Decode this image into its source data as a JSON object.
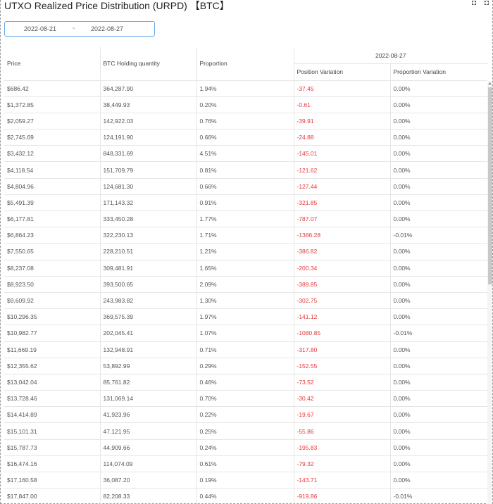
{
  "page": {
    "title": "UTXO Realized Price Distribution (URPD) 【BTC】"
  },
  "date_range": {
    "start": "2022-08-21",
    "separator": "~",
    "end": "2022-08-27"
  },
  "table": {
    "columns": {
      "price": "Price",
      "holding": "BTC Holding quantity",
      "proportion": "Proportion",
      "group_date": "2022-08-27",
      "position_variation": "Position Variation",
      "proportion_variation": "Proportion Variation"
    },
    "rows": [
      {
        "price": "$686.42",
        "holding": "364,287.90",
        "proportion": "1.94%",
        "pos_var": "-37.45",
        "prop_var": "0.00%"
      },
      {
        "price": "$1,372.85",
        "holding": "38,449.93",
        "proportion": "0.20%",
        "pos_var": "-0.61",
        "prop_var": "0.00%"
      },
      {
        "price": "$2,059.27",
        "holding": "142,922.03",
        "proportion": "0.76%",
        "pos_var": "-39.91",
        "prop_var": "0.00%"
      },
      {
        "price": "$2,745.69",
        "holding": "124,191.90",
        "proportion": "0.66%",
        "pos_var": "-24.88",
        "prop_var": "0.00%"
      },
      {
        "price": "$3,432.12",
        "holding": "848,331.69",
        "proportion": "4.51%",
        "pos_var": "-145.01",
        "prop_var": "0.00%"
      },
      {
        "price": "$4,118.54",
        "holding": "151,709.79",
        "proportion": "0.81%",
        "pos_var": "-121.62",
        "prop_var": "0.00%"
      },
      {
        "price": "$4,804.96",
        "holding": "124,681.30",
        "proportion": "0.66%",
        "pos_var": "-127.44",
        "prop_var": "0.00%"
      },
      {
        "price": "$5,491.39",
        "holding": "171,143.32",
        "proportion": "0.91%",
        "pos_var": "-321.85",
        "prop_var": "0.00%"
      },
      {
        "price": "$6,177.81",
        "holding": "333,450.28",
        "proportion": "1.77%",
        "pos_var": "-787.07",
        "prop_var": "0.00%"
      },
      {
        "price": "$6,864.23",
        "holding": "322,230.13",
        "proportion": "1.71%",
        "pos_var": "-1386.28",
        "prop_var": "-0.01%"
      },
      {
        "price": "$7,550.65",
        "holding": "228,210.51",
        "proportion": "1.21%",
        "pos_var": "-386.82",
        "prop_var": "0.00%"
      },
      {
        "price": "$8,237.08",
        "holding": "309,481.91",
        "proportion": "1.65%",
        "pos_var": "-200.34",
        "prop_var": "0.00%"
      },
      {
        "price": "$8,923.50",
        "holding": "393,500.65",
        "proportion": "2.09%",
        "pos_var": "-389.85",
        "prop_var": "0.00%"
      },
      {
        "price": "$9,609.92",
        "holding": "243,983.82",
        "proportion": "1.30%",
        "pos_var": "-302.75",
        "prop_var": "0.00%"
      },
      {
        "price": "$10,296.35",
        "holding": "369,575.39",
        "proportion": "1.97%",
        "pos_var": "-141.12",
        "prop_var": "0.00%"
      },
      {
        "price": "$10,982.77",
        "holding": "202,045.41",
        "proportion": "1.07%",
        "pos_var": "-1080.85",
        "prop_var": "-0.01%"
      },
      {
        "price": "$11,669.19",
        "holding": "132,948.91",
        "proportion": "0.71%",
        "pos_var": "-317.80",
        "prop_var": "0.00%"
      },
      {
        "price": "$12,355.62",
        "holding": "53,892.99",
        "proportion": "0.29%",
        "pos_var": "-152.55",
        "prop_var": "0.00%"
      },
      {
        "price": "$13,042.04",
        "holding": "85,761.82",
        "proportion": "0.46%",
        "pos_var": "-73.52",
        "prop_var": "0.00%"
      },
      {
        "price": "$13,728.46",
        "holding": "131,069.14",
        "proportion": "0.70%",
        "pos_var": "-30.42",
        "prop_var": "0.00%"
      },
      {
        "price": "$14,414.89",
        "holding": "41,923.96",
        "proportion": "0.22%",
        "pos_var": "-19.67",
        "prop_var": "0.00%"
      },
      {
        "price": "$15,101.31",
        "holding": "47,121.95",
        "proportion": "0.25%",
        "pos_var": "-55.86",
        "prop_var": "0.00%"
      },
      {
        "price": "$15,787.73",
        "holding": "44,909.66",
        "proportion": "0.24%",
        "pos_var": "-195.83",
        "prop_var": "0.00%"
      },
      {
        "price": "$16,474.16",
        "holding": "114,074.09",
        "proportion": "0.61%",
        "pos_var": "-79.32",
        "prop_var": "0.00%"
      },
      {
        "price": "$17,160.58",
        "holding": "36,087.20",
        "proportion": "0.19%",
        "pos_var": "-143.71",
        "prop_var": "0.00%"
      },
      {
        "price": "$17,847.00",
        "holding": "82,208.33",
        "proportion": "0.44%",
        "pos_var": "-919.86",
        "prop_var": "-0.01%"
      }
    ]
  },
  "colors": {
    "negative": "#e8383d",
    "accent_border": "#6aa9e6"
  },
  "icons": {
    "expand": "expand-icon"
  }
}
